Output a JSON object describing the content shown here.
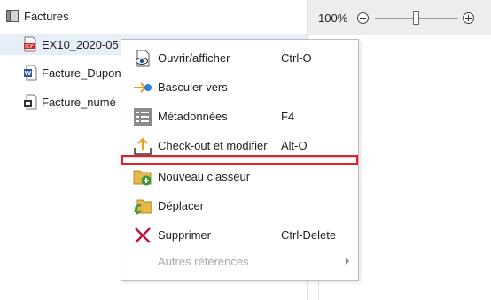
{
  "tree": {
    "root": {
      "label": "Factures",
      "icon": "folder-gray-icon"
    },
    "items": [
      {
        "label": "EX10_2020-05",
        "icon": "pdf-file-icon",
        "selected": true
      },
      {
        "label": "Facture_Dupon",
        "icon": "word-file-icon"
      },
      {
        "label": "Facture_numé",
        "icon": "scanned-file-icon"
      }
    ]
  },
  "zoom": {
    "label": "100%",
    "minus_icon": "zoom-out-icon",
    "plus_icon": "zoom-in-icon",
    "level": 0.5
  },
  "context_menu": {
    "items": [
      {
        "label": "Ouvrir/afficher",
        "shortcut": "Ctrl-O",
        "icon": "eye-document-icon"
      },
      {
        "label": "Basculer vers",
        "shortcut": "",
        "icon": "switch-arrow-icon"
      },
      {
        "label": "Métadonnées",
        "shortcut": "F4",
        "icon": "metadata-list-icon"
      },
      {
        "label": "Check-out et modifier",
        "shortcut": "Alt-O",
        "icon": "check-out-icon"
      },
      {
        "label": "Nouveau classeur",
        "shortcut": "",
        "icon": "new-folder-icon"
      },
      {
        "label": "Déplacer",
        "shortcut": "",
        "icon": "move-folder-icon"
      },
      {
        "label": "Supprimer",
        "shortcut": "Ctrl-Delete",
        "icon": "delete-x-icon"
      },
      {
        "label": "Autres références",
        "shortcut": "",
        "icon": "",
        "disabled": true,
        "has_submenu": true
      }
    ]
  },
  "colors": {
    "highlight": "#e0202a",
    "selected_row": "#e6eef8",
    "delete": "#c0143c",
    "folder": "#e6b84a",
    "arrow": "#e8a020",
    "dot": "#2f7fd6"
  }
}
